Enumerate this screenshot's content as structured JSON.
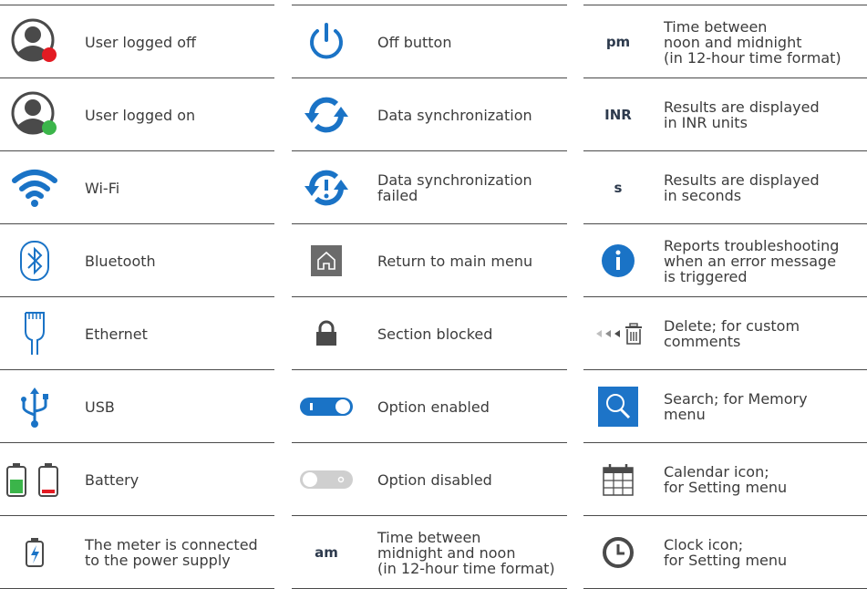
{
  "columns": [
    {
      "rows": [
        {
          "icon": "user-offline-icon",
          "label": "User logged off"
        },
        {
          "icon": "user-online-icon",
          "label": "User logged on"
        },
        {
          "icon": "wifi-icon",
          "label": "Wi-Fi"
        },
        {
          "icon": "bluetooth-icon",
          "label": "Bluetooth"
        },
        {
          "icon": "ethernet-icon",
          "label": "Ethernet"
        },
        {
          "icon": "usb-icon",
          "label": "USB"
        },
        {
          "icon": "battery-icon",
          "label": "Battery"
        },
        {
          "icon": "power-supply-icon",
          "label": "The meter is connected\nto the power supply"
        }
      ]
    },
    {
      "rows": [
        {
          "icon": "power-off-icon",
          "label": "Off button"
        },
        {
          "icon": "sync-icon",
          "label": "Data synchronization"
        },
        {
          "icon": "sync-failed-icon",
          "label": "Data synchronization\nfailed"
        },
        {
          "icon": "home-icon",
          "label": "Return to main menu"
        },
        {
          "icon": "lock-icon",
          "label": "Section blocked"
        },
        {
          "icon": "toggle-on-icon",
          "label": "Option enabled"
        },
        {
          "icon": "toggle-off-icon",
          "label": "Option disabled"
        },
        {
          "icon": "am-unit",
          "unit": "am",
          "label": "Time between\nmidnight and noon\n(in 12-hour time format)"
        }
      ]
    },
    {
      "rows": [
        {
          "icon": "pm-unit",
          "unit": "pm",
          "label": "Time between\nnoon and midnight\n(in 12-hour time format)"
        },
        {
          "icon": "inr-unit",
          "unit": "INR",
          "label": "Results are displayed\nin INR units"
        },
        {
          "icon": "seconds-unit",
          "unit": "s",
          "label": "Results are displayed\nin seconds"
        },
        {
          "icon": "info-icon",
          "label": "Reports troubleshooting\nwhen an error message\nis triggered"
        },
        {
          "icon": "delete-icon",
          "label": "Delete; for custom\ncomments"
        },
        {
          "icon": "search-icon",
          "label": "Search; for Memory\nmenu"
        },
        {
          "icon": "calendar-icon",
          "label": "Calendar icon;\nfor Setting menu"
        },
        {
          "icon": "clock-icon",
          "label": "Clock icon;\nfor Setting menu"
        }
      ]
    }
  ],
  "colors": {
    "accent": "#1a73c6",
    "online": "#3bb54a",
    "offline": "#e31b23",
    "rule": "#4a4a4a"
  }
}
